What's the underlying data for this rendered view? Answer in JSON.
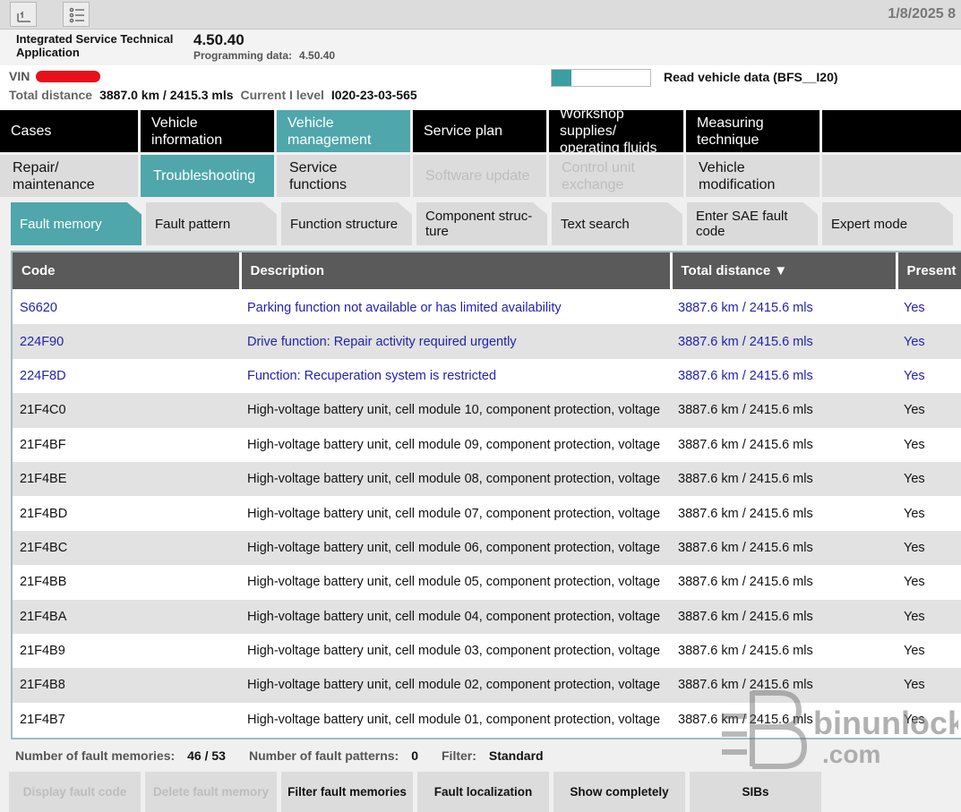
{
  "toolbar": {
    "date": "1/8/2025 8"
  },
  "header": {
    "app_name": "Integrated Service Technical Application",
    "version": "4.50.40",
    "programming_label": "Programming data:",
    "programming_value": "4.50.40"
  },
  "vehicle": {
    "vin_label": "VIN",
    "total_distance_label": "Total distance",
    "total_distance_value": "3887.0 km / 2415.3 mls",
    "i_level_label": "Current I level",
    "i_level_value": "I020-23-03-565",
    "read_vehicle_data": "Read vehicle data (BFS__I20)",
    "progress_fraction": 0.2
  },
  "nav_main": [
    {
      "label": "Cases"
    },
    {
      "label": "Vehicle information"
    },
    {
      "label": "Vehicle management"
    },
    {
      "label": "Service plan"
    },
    {
      "label": "Workshop supplies/ operating fluids"
    },
    {
      "label": "Measuring technique"
    },
    {
      "label": ""
    }
  ],
  "nav_sub": [
    {
      "label": "Repair/ maintenance"
    },
    {
      "label": "Troubleshooting"
    },
    {
      "label": "Service functions"
    },
    {
      "label": "Software update"
    },
    {
      "label": "Control unit exchange"
    },
    {
      "label": "Vehicle modification"
    },
    {
      "label": ""
    }
  ],
  "tabs": [
    {
      "label": "Fault memory"
    },
    {
      "label": "Fault pattern"
    },
    {
      "label": "Function structure"
    },
    {
      "label": "Component struc-ture"
    },
    {
      "label": "Text search"
    },
    {
      "label": "Enter SAE fault code"
    },
    {
      "label": "Expert mode"
    }
  ],
  "table": {
    "headers": [
      "Code",
      "Description",
      "Total distance ▼",
      "Present"
    ],
    "rows": [
      {
        "code": "S6620",
        "description": "Parking function not available or has limited availability",
        "distance": "3887.6 km / 2415.6 mls",
        "present": "Yes"
      },
      {
        "code": "224F90",
        "description": "Drive function: Repair activity required urgently",
        "distance": "3887.6 km / 2415.6 mls",
        "present": "Yes"
      },
      {
        "code": "224F8D",
        "description": "Function: Recuperation system is restricted",
        "distance": "3887.6 km / 2415.6 mls",
        "present": "Yes"
      },
      {
        "code": "21F4C0",
        "description": "High-voltage battery unit, cell module 10, component protection, voltage",
        "distance": "3887.6 km / 2415.6 mls",
        "present": "Yes"
      },
      {
        "code": "21F4BF",
        "description": "High-voltage battery unit, cell module 09, component protection, voltage",
        "distance": "3887.6 km / 2415.6 mls",
        "present": "Yes"
      },
      {
        "code": "21F4BE",
        "description": "High-voltage battery unit, cell module 08, component protection, voltage",
        "distance": "3887.6 km / 2415.6 mls",
        "present": "Yes"
      },
      {
        "code": "21F4BD",
        "description": "High-voltage battery unit, cell module 07, component protection, voltage",
        "distance": "3887.6 km / 2415.6 mls",
        "present": "Yes"
      },
      {
        "code": "21F4BC",
        "description": "High-voltage battery unit, cell module 06, component protection, voltage",
        "distance": "3887.6 km / 2415.6 mls",
        "present": "Yes"
      },
      {
        "code": "21F4BB",
        "description": "High-voltage battery unit, cell module 05, component protection, voltage",
        "distance": "3887.6 km / 2415.6 mls",
        "present": "Yes"
      },
      {
        "code": "21F4BA",
        "description": "High-voltage battery unit, cell module 04, component protection, voltage",
        "distance": "3887.6 km / 2415.6 mls",
        "present": "Yes"
      },
      {
        "code": "21F4B9",
        "description": "High-voltage battery unit, cell module 03, component protection, voltage",
        "distance": "3887.6 km / 2415.6 mls",
        "present": "Yes"
      },
      {
        "code": "21F4B8",
        "description": "High-voltage battery unit, cell module 02, component protection, voltage",
        "distance": "3887.6 km / 2415.6 mls",
        "present": "Yes"
      },
      {
        "code": "21F4B7",
        "description": "High-voltage battery unit, cell module 01, component protection, voltage",
        "distance": "3887.6 km / 2415.6 mls",
        "present": "Yes"
      }
    ]
  },
  "summary": {
    "fault_memories_label": "Number of fault memories:",
    "fault_memories_value": "46 / 53",
    "fault_patterns_label": "Number of fault patterns:",
    "fault_patterns_value": "0",
    "filter_label": "Filter:",
    "filter_value": "Standard"
  },
  "buttons": [
    {
      "label": "Display fault code"
    },
    {
      "label": "Delete fault memory"
    },
    {
      "label": "Filter fault memories"
    },
    {
      "label": "Fault localization"
    },
    {
      "label": "Show completely"
    },
    {
      "label": "SIBs"
    }
  ],
  "watermark": {
    "line1": "binunlock",
    "line2": ".com"
  },
  "colors": {
    "accent": "#4fa7ab",
    "link": "#2222b4",
    "header_bg": "#5a5a5a"
  }
}
